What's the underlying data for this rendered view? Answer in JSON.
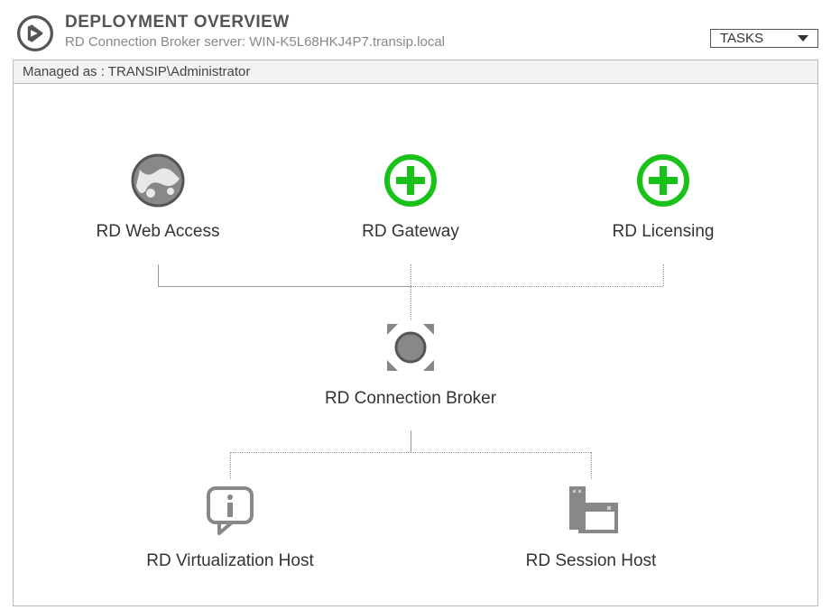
{
  "header": {
    "title": "DEPLOYMENT OVERVIEW",
    "sub_label": "RD Connection Broker server: WIN-K5L68HKJ4P7.transip.local",
    "tasks_label": "TASKS"
  },
  "managed": "Managed as : TRANSIP\\Administrator",
  "nodes": {
    "web_access": "RD Web Access",
    "gateway": "RD Gateway",
    "licensing": "RD Licensing",
    "connection_broker": "RD Connection Broker",
    "virtualization_host": "RD Virtualization Host",
    "session_host": "RD Session Host"
  }
}
